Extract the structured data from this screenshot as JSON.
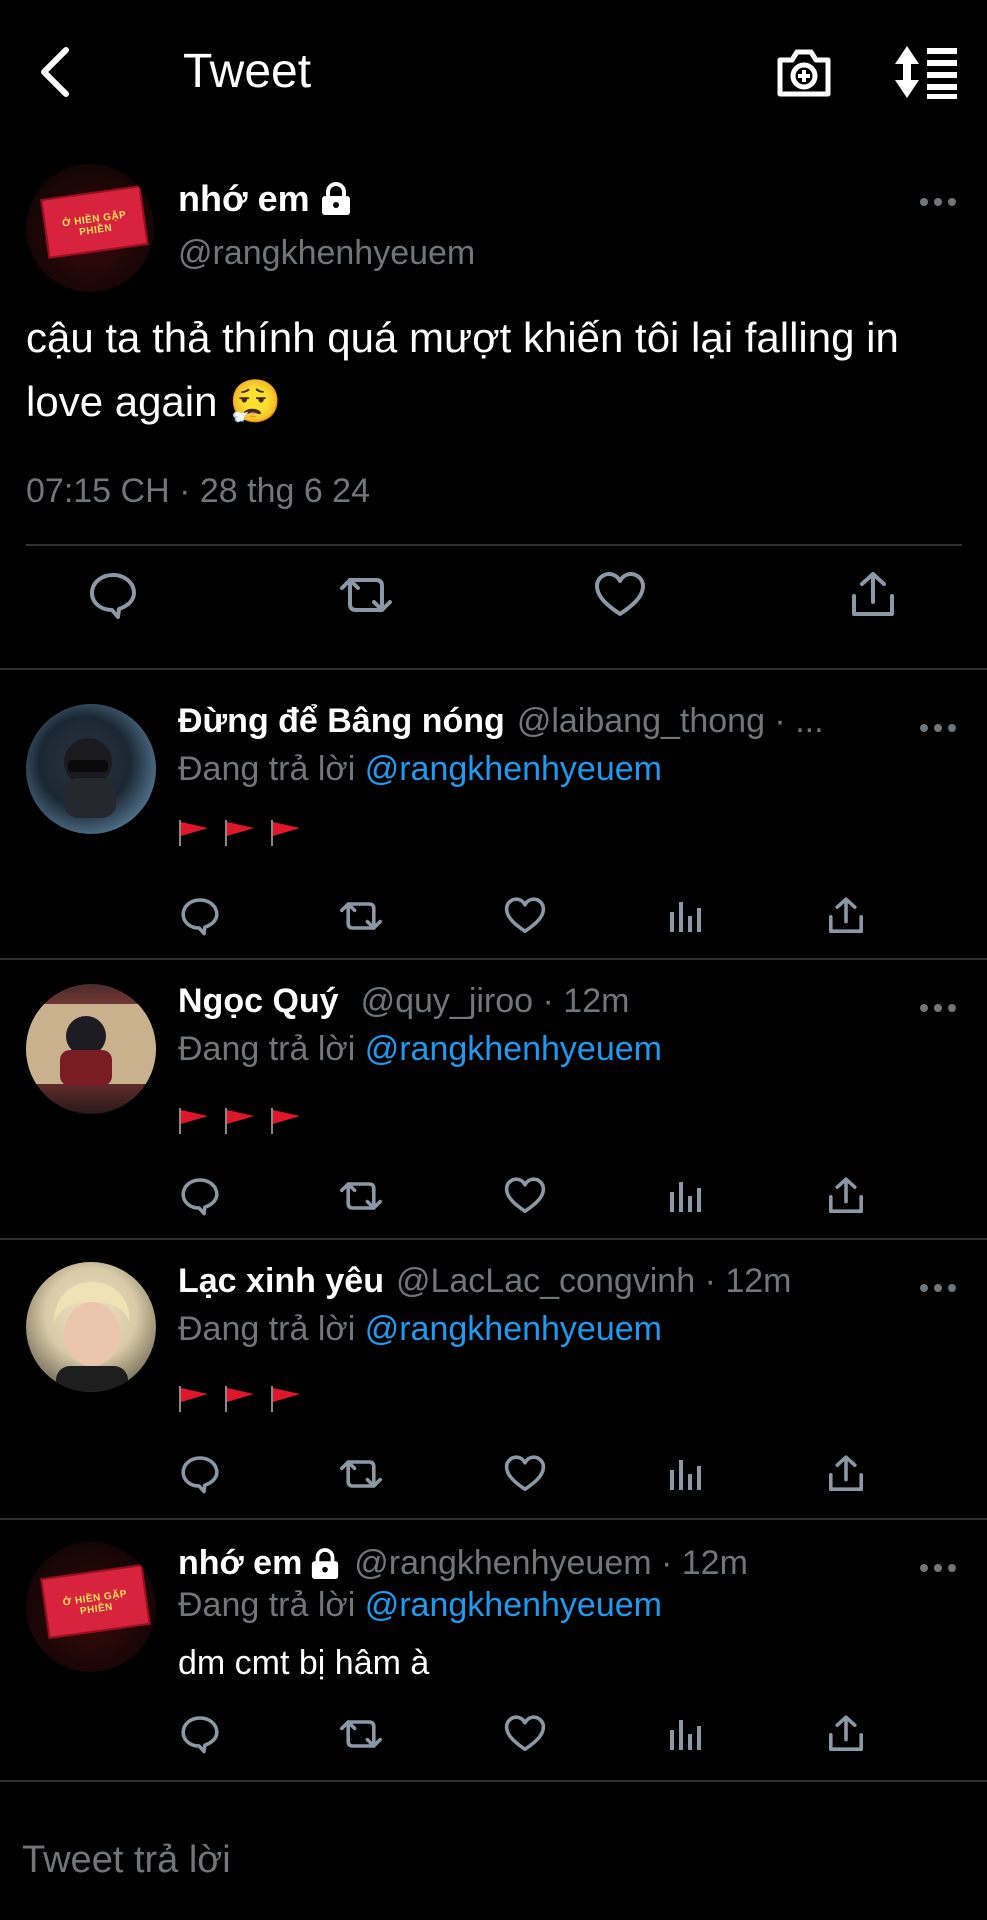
{
  "header": {
    "title": "Tweet",
    "icons": [
      "back-arrow-icon",
      "camera-plus-icon",
      "sort-list-icon"
    ]
  },
  "main_tweet": {
    "name": "nhớ em",
    "handle": "@rangkhenhyeuem",
    "avatar_sign": "Ở HIỀN GẶP PHIỀN",
    "text": "cậu ta thả thính quá mượt khiến tôi lại falling in love again 😮‍💨",
    "meta": "07:15 CH · 28 thg 6 24",
    "actions": [
      "reply-icon",
      "retweet-icon",
      "like-icon",
      "share-icon"
    ]
  },
  "replies": [
    {
      "name": "Đừng để Bâng nóng",
      "handle_time": "@laibang_thong · ...",
      "replying_prefix": "Đang trả lời",
      "replying_to": "@rangkhenhyeuem",
      "body": "",
      "flags": 3,
      "avatar_color": "#7fb0d6"
    },
    {
      "name": "Ngọc Quý",
      "handle_time": "@quy_jiroo · 12m",
      "replying_prefix": "Đang trả lời",
      "replying_to": "@rangkhenhyeuem",
      "body": "",
      "flags": 3,
      "avatar_color": "#b0473c"
    },
    {
      "name": "Lạc xinh yêu",
      "handle_time": "@LacLac_congvinh · 12m",
      "replying_prefix": "Đang trả lời",
      "replying_to": "@rangkhenhyeuem",
      "body": "",
      "flags": 3,
      "avatar_color": "#d8cba8"
    },
    {
      "name": "nhớ em",
      "handle_time": "@rangkhenhyeuem · 12m",
      "replying_prefix": "Đang trả lời",
      "replying_to": "@rangkhenhyeuem",
      "body": "dm cmt bị hâm à",
      "flags": 0,
      "avatar_color": "#d8233f"
    }
  ],
  "composer": {
    "placeholder": "Tweet trả lời"
  },
  "colors": {
    "background": "#000000",
    "link": "#1d9bf0",
    "muted": "#71767b",
    "divider": "#2f3336",
    "flag": "#e0162b"
  }
}
